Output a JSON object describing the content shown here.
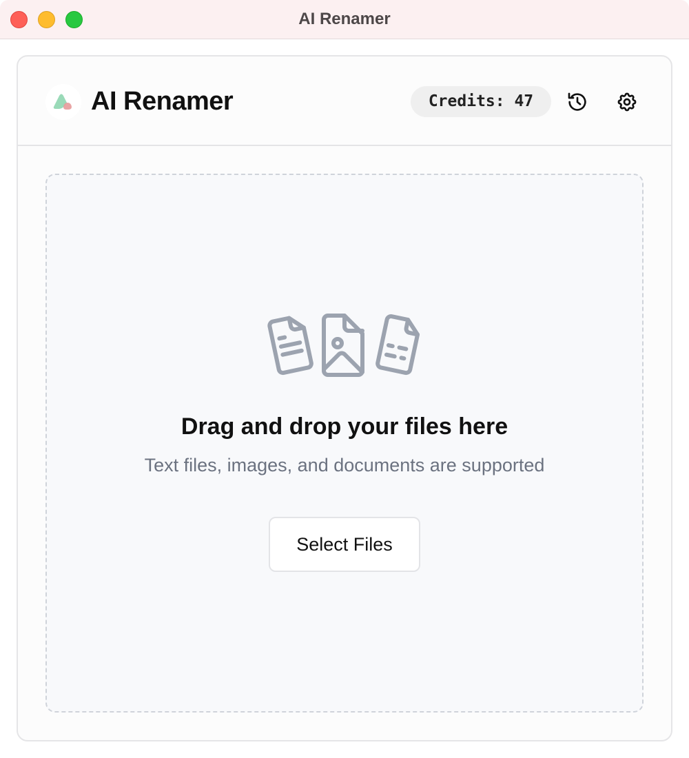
{
  "window": {
    "title": "AI Renamer"
  },
  "header": {
    "app_title": "AI Renamer",
    "credits_label": "Credits: 47",
    "logo_colors": [
      "#8fd6b0",
      "#e79a9a"
    ]
  },
  "toolbar": {
    "history_icon": "history-icon",
    "settings_icon": "gear-icon"
  },
  "dropzone": {
    "title": "Drag and drop your files here",
    "subtitle": "Text files, images, and documents are supported",
    "button_label": "Select Files",
    "icons": [
      "text-file-icon",
      "image-file-icon",
      "document-file-icon"
    ],
    "icon_color": "#9ca3af"
  },
  "colors": {
    "titlebar_bg": "#fcf0f1",
    "card_bg": "#fcfcfc",
    "dropzone_bg": "#f8f9fb",
    "muted_text": "#6b7280"
  }
}
